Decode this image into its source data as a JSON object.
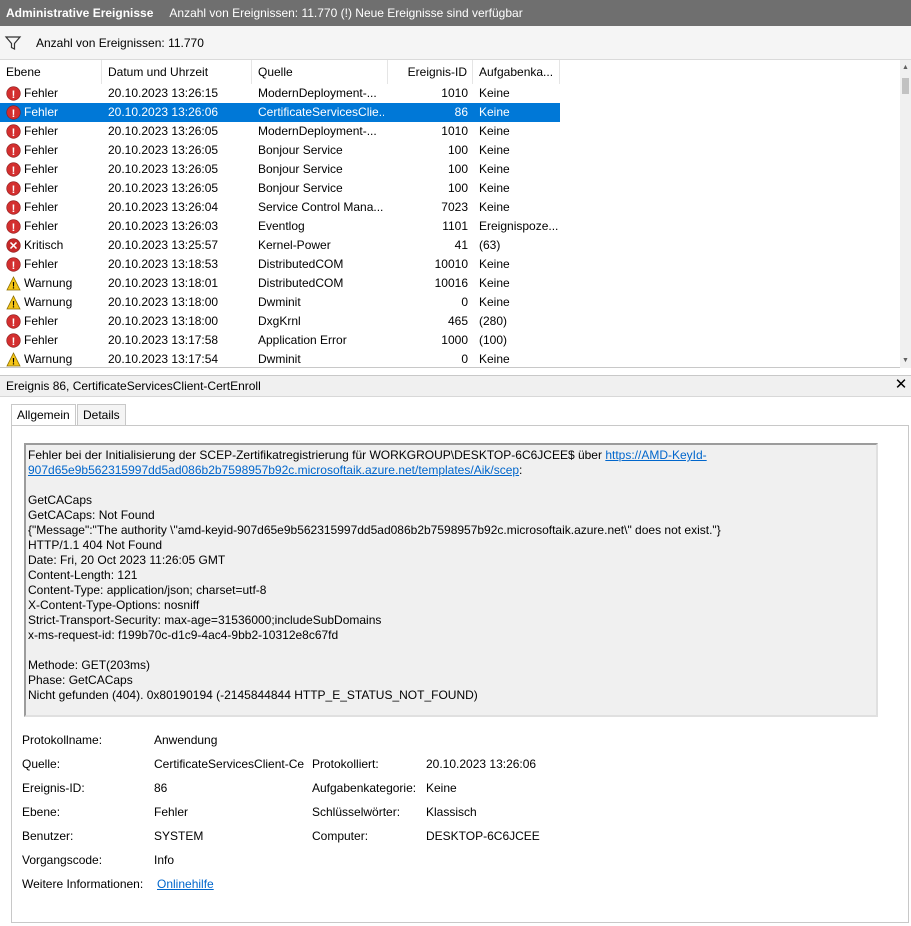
{
  "titlebar": {
    "app_title": "Administrative Ereignisse",
    "info": "Anzahl von Ereignissen: 11.770 (!) Neue Ereignisse sind verfügbar"
  },
  "filter": {
    "label": "Anzahl von Ereignissen: 11.770",
    "icon": "filter-icon"
  },
  "columns": {
    "ebene": "Ebene",
    "datum": "Datum und Uhrzeit",
    "quelle": "Quelle",
    "id": "Ereignis-ID",
    "kategorie": "Aufgabenka..."
  },
  "events": [
    {
      "level_icon": "error-icon",
      "level": "Fehler",
      "date": "20.10.2023 13:26:15",
      "source": "ModernDeployment-...",
      "id": "1010",
      "category": "Keine"
    },
    {
      "level_icon": "error-icon",
      "level": "Fehler",
      "date": "20.10.2023 13:26:06",
      "source": "CertificateServicesClie...",
      "id": "86",
      "category": "Keine"
    },
    {
      "level_icon": "error-icon",
      "level": "Fehler",
      "date": "20.10.2023 13:26:05",
      "source": "ModernDeployment-...",
      "id": "1010",
      "category": "Keine"
    },
    {
      "level_icon": "error-icon",
      "level": "Fehler",
      "date": "20.10.2023 13:26:05",
      "source": "Bonjour Service",
      "id": "100",
      "category": "Keine"
    },
    {
      "level_icon": "error-icon",
      "level": "Fehler",
      "date": "20.10.2023 13:26:05",
      "source": "Bonjour Service",
      "id": "100",
      "category": "Keine"
    },
    {
      "level_icon": "error-icon",
      "level": "Fehler",
      "date": "20.10.2023 13:26:05",
      "source": "Bonjour Service",
      "id": "100",
      "category": "Keine"
    },
    {
      "level_icon": "error-icon",
      "level": "Fehler",
      "date": "20.10.2023 13:26:04",
      "source": "Service Control Mana...",
      "id": "7023",
      "category": "Keine"
    },
    {
      "level_icon": "error-icon",
      "level": "Fehler",
      "date": "20.10.2023 13:26:03",
      "source": "Eventlog",
      "id": "1101",
      "category": "Ereignispoze..."
    },
    {
      "level_icon": "critical-icon",
      "level": "Kritisch",
      "date": "20.10.2023 13:25:57",
      "source": "Kernel-Power",
      "id": "41",
      "category": "(63)"
    },
    {
      "level_icon": "error-icon",
      "level": "Fehler",
      "date": "20.10.2023 13:18:53",
      "source": "DistributedCOM",
      "id": "10010",
      "category": "Keine"
    },
    {
      "level_icon": "warning-icon",
      "level": "Warnung",
      "date": "20.10.2023 13:18:01",
      "source": "DistributedCOM",
      "id": "10016",
      "category": "Keine"
    },
    {
      "level_icon": "warning-icon",
      "level": "Warnung",
      "date": "20.10.2023 13:18:00",
      "source": "Dwminit",
      "id": "0",
      "category": "Keine"
    },
    {
      "level_icon": "error-icon",
      "level": "Fehler",
      "date": "20.10.2023 13:18:00",
      "source": "DxgKrnl",
      "id": "465",
      "category": "(280)"
    },
    {
      "level_icon": "error-icon",
      "level": "Fehler",
      "date": "20.10.2023 13:17:58",
      "source": "Application Error",
      "id": "1000",
      "category": "(100)"
    },
    {
      "level_icon": "warning-icon",
      "level": "Warnung",
      "date": "20.10.2023 13:17:54",
      "source": "Dwminit",
      "id": "0",
      "category": "Keine"
    }
  ],
  "selected_row": 1,
  "detail": {
    "header": "Ereignis 86, CertificateServicesClient-CertEnroll",
    "close_glyph": "✕",
    "tabs": [
      "Allgemein",
      "Details"
    ],
    "message": {
      "line1_text": "Fehler bei der Initialisierung der SCEP-Zertifikatregistrierung für WORKGROUP\\DESKTOP-6C6JCEE$ über ",
      "link_part1": "https://AMD-KeyId-",
      "link_part2": "907d65e9b562315997dd5ad086b2b7598957b92c.microsoftaik.azure.net/templates/Aik/scep",
      "link_tail": ":",
      "lines": [
        "GetCACaps",
        "GetCACaps: Not Found",
        "{\"Message\":\"The authority \\\"amd-keyid-907d65e9b562315997dd5ad086b2b7598957b92c.microsoftaik.azure.net\\\" does not exist.\"}",
        "HTTP/1.1 404 Not Found",
        "Date: Fri, 20 Oct 2023 11:26:05 GMT",
        "Content-Length: 121",
        "Content-Type: application/json; charset=utf-8",
        "X-Content-Type-Options: nosniff",
        "Strict-Transport-Security: max-age=31536000;includeSubDomains",
        "x-ms-request-id: f199b70c-d1c9-4ac4-9bb2-10312e8c67fd"
      ],
      "lines2": [
        "Methode: GET(203ms)",
        "Phase: GetCACaps",
        "Nicht gefunden (404). 0x80190194 (-2145844844 HTTP_E_STATUS_NOT_FOUND)"
      ]
    },
    "props": {
      "protokollname_label": "Protokollname:",
      "protokollname": "Anwendung",
      "quelle_label": "Quelle:",
      "quelle": "CertificateServicesClient-Cer",
      "protokolliert_label": "Protokolliert:",
      "protokolliert": "20.10.2023 13:26:06",
      "ereignis_id_label": "Ereignis-ID:",
      "ereignis_id": "86",
      "aufgabenkategorie_label": "Aufgabenkategorie:",
      "aufgabenkategorie": "Keine",
      "ebene_label": "Ebene:",
      "ebene": "Fehler",
      "schluesselwoerter_label": "Schlüsselwörter:",
      "schluesselwoerter": "Klassisch",
      "benutzer_label": "Benutzer:",
      "benutzer": "SYSTEM",
      "computer_label": "Computer:",
      "computer": "DESKTOP-6C6JCEE",
      "vorgangscode_label": "Vorgangscode:",
      "vorgangscode": "Info",
      "weitere_label": "Weitere Informationen:",
      "weitere_link": "Onlinehilfe"
    }
  },
  "colors": {
    "selection": "#0078d7",
    "error": "#d32f2f",
    "critical": "#c62828",
    "warning": "#f5c518"
  }
}
